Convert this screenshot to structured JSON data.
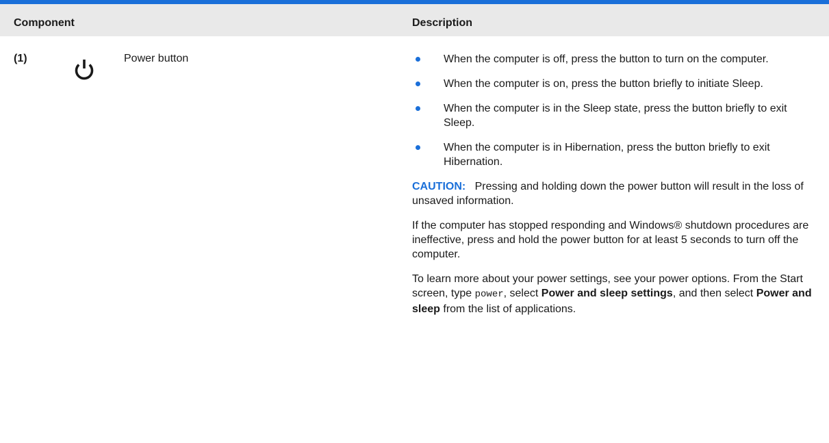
{
  "header": {
    "component_label": "Component",
    "description_label": "Description"
  },
  "row": {
    "number": "(1)",
    "icon": "power-icon",
    "component_name": "Power button",
    "bullets": [
      "When the computer is off, press the button to turn on the computer.",
      "When the computer is on, press the button briefly to initiate Sleep.",
      "When the computer is in the Sleep state, press the button briefly to exit Sleep.",
      "When the computer is in Hibernation, press the button briefly to exit Hibernation."
    ],
    "caution_label": "CAUTION:",
    "caution_text": "Pressing and holding down the power button will result in the loss of unsaved information.",
    "unresponsive_text": "If the computer has stopped responding and Windows® shutdown procedures are ineffective, press and hold the power button for at least 5 seconds to turn off the computer.",
    "settings": {
      "part1": "To learn more about your power settings, see your power options. From the Start screen, type ",
      "code": "power",
      "part2": ", select ",
      "bold1": "Power and sleep settings",
      "part3": ", and then select ",
      "bold2": "Power and sleep",
      "part4": " from the list of applications."
    }
  },
  "colors": {
    "accent": "#1a6fd9",
    "header_bg": "#e9e9e9",
    "text": "#1a1a1a"
  }
}
